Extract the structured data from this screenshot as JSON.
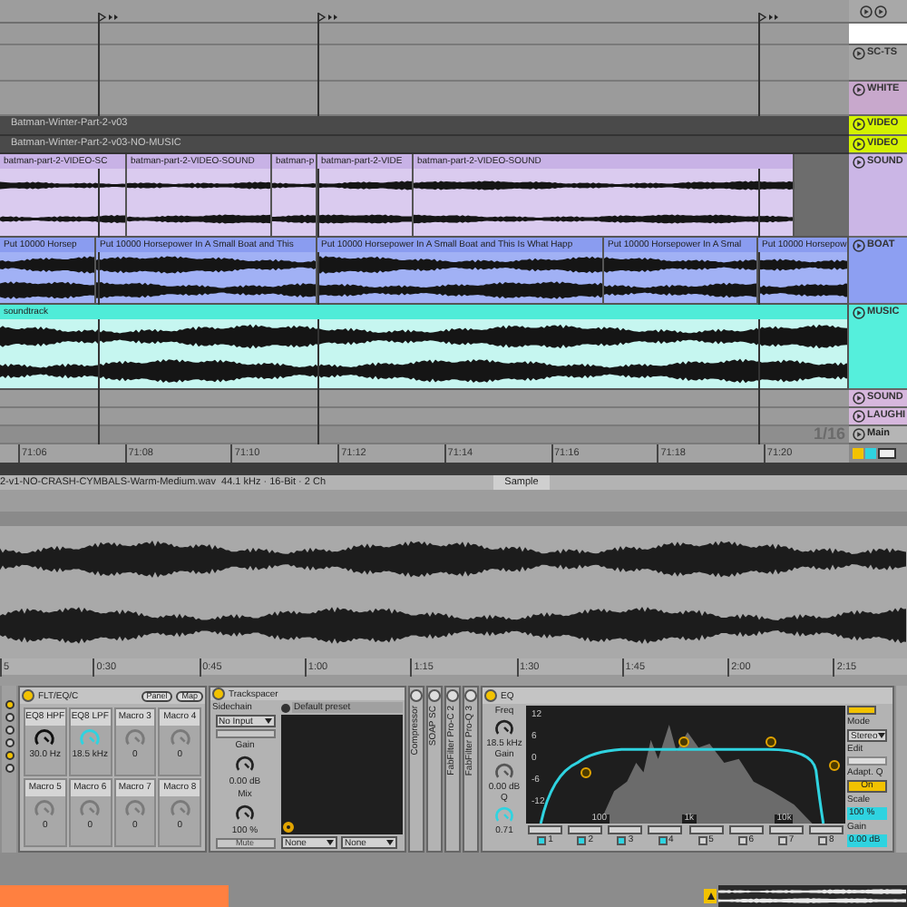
{
  "tracks": [
    {
      "kind": "empty",
      "color": "#ffffff"
    },
    {
      "kind": "empty",
      "name": "SC-TS",
      "color": "#a6a6a6"
    },
    {
      "kind": "empty",
      "name": "WHITE",
      "color": "#c8a8cc"
    },
    {
      "kind": "video",
      "name": "VIDEO",
      "color": "#d4f200",
      "clips": [
        {
          "label": "Batman-Winter-Part-2-v03"
        }
      ]
    },
    {
      "kind": "video",
      "name": "VIDEO",
      "color": "#d4f200",
      "clips": [
        {
          "label": "Batman-Winter-Part-2-v03-NO-MUSIC"
        }
      ]
    },
    {
      "kind": "audio",
      "name": "SOUND",
      "color": "#cbb6e6",
      "clips": [
        {
          "label": "batman-part-2-VIDEO-SC"
        },
        {
          "label": "batman-part-2-VIDEO-SOUND"
        },
        {
          "label": "batman-p"
        },
        {
          "label": "batman-part-2-VIDE"
        },
        {
          "label": "batman-part-2-VIDEO-SOUND"
        }
      ]
    },
    {
      "kind": "audio",
      "name": "BOAT",
      "color": "#8d9ff2",
      "clips": [
        {
          "label": "Put 10000 Horsep"
        },
        {
          "label": "Put 10000 Horsepower In A Small Boat and This"
        },
        {
          "label": "Put 10000 Horsepower In A Small Boat and This Is What Happ"
        },
        {
          "label": "Put 10000 Horsepower In A Smal"
        },
        {
          "label": "Put 10000 Horsepow"
        }
      ]
    },
    {
      "kind": "audio",
      "name": "MUSIC",
      "color": "#55efdc",
      "clips": [
        {
          "label": "soundtrack"
        }
      ]
    },
    {
      "kind": "empty",
      "name": "SOUND",
      "color": "#d6b7dd"
    },
    {
      "kind": "empty",
      "name": "LAUGHI",
      "color": "#d6b7dd"
    },
    {
      "kind": "main",
      "name": "Main",
      "color": "#b5b5b5"
    }
  ],
  "grid": "1/16",
  "ruler": [
    "71:06",
    "71:08",
    "71:10",
    "71:12",
    "71:14",
    "71:16",
    "71:18",
    "71:20"
  ],
  "clip_view": {
    "info": "2-v1-NO-CRASH-CYMBALS-Warm-Medium.wav  44.1 kHz · 16-Bit · 2 Ch",
    "tab": "Sample",
    "ruler": [
      "5",
      "0:30",
      "0:45",
      "1:00",
      "1:15",
      "1:30",
      "1:45",
      "2:00",
      "2:15"
    ]
  },
  "rack": {
    "title": "FLT/EQ/C",
    "buttons": [
      "Panel",
      "Map"
    ],
    "macros": [
      {
        "label": "EQ8 HPF",
        "value": "30.0 Hz",
        "color": "#111111"
      },
      {
        "label": "EQ8 LPF",
        "value": "18.5 kHz",
        "color": "#2fd3e0"
      },
      {
        "label": "Macro 3",
        "value": "0",
        "color": "#7a7a7a"
      },
      {
        "label": "Macro 4",
        "value": "0",
        "color": "#7a7a7a"
      },
      {
        "label": "Macro 5",
        "value": "0",
        "color": "#7a7a7a"
      },
      {
        "label": "Macro 6",
        "value": "0",
        "color": "#7a7a7a"
      },
      {
        "label": "Macro 7",
        "value": "0",
        "color": "#7a7a7a"
      },
      {
        "label": "Macro 8",
        "value": "0",
        "color": "#7a7a7a"
      }
    ]
  },
  "trackspacer": {
    "title": "Trackspacer",
    "sidechain_label": "Sidechain",
    "sidechain": "No Input",
    "gain_label": "Gain",
    "gain": "0.00 dB",
    "mix_label": "Mix",
    "mix": "100 %",
    "mute": "Mute",
    "preset": "Default preset",
    "selects": [
      "None",
      "None"
    ]
  },
  "collapsed_devices": [
    "Compressor",
    "SOAP SC",
    "FabFilter Pro-C 2",
    "FabFilter Pro-Q 3"
  ],
  "eq": {
    "title": "EQ",
    "freq_label": "Freq",
    "freq": "18.5 kHz",
    "gain_label": "Gain",
    "gain": "0.00 dB",
    "q_label": "Q",
    "q": "0.71",
    "y_labels": [
      "12",
      "6",
      "0",
      "-6",
      "-12"
    ],
    "x_labels": [
      "100",
      "1k",
      "10k"
    ],
    "bands": [
      {
        "label": "1",
        "on": true
      },
      {
        "label": "2",
        "on": true
      },
      {
        "label": "3",
        "on": true
      },
      {
        "label": "4",
        "on": true
      },
      {
        "label": "5",
        "on": false
      },
      {
        "label": "6",
        "on": false
      },
      {
        "label": "7",
        "on": false
      },
      {
        "label": "8",
        "on": false
      }
    ],
    "mode_label": "Mode",
    "mode": "Stereo",
    "edit_label": "Edit",
    "adapt_label": "Adapt. Q",
    "adapt": "On",
    "adapt_on": true,
    "scale_label": "Scale",
    "scale": "100 %",
    "out_label": "Gain",
    "out": "0.00 dB"
  }
}
